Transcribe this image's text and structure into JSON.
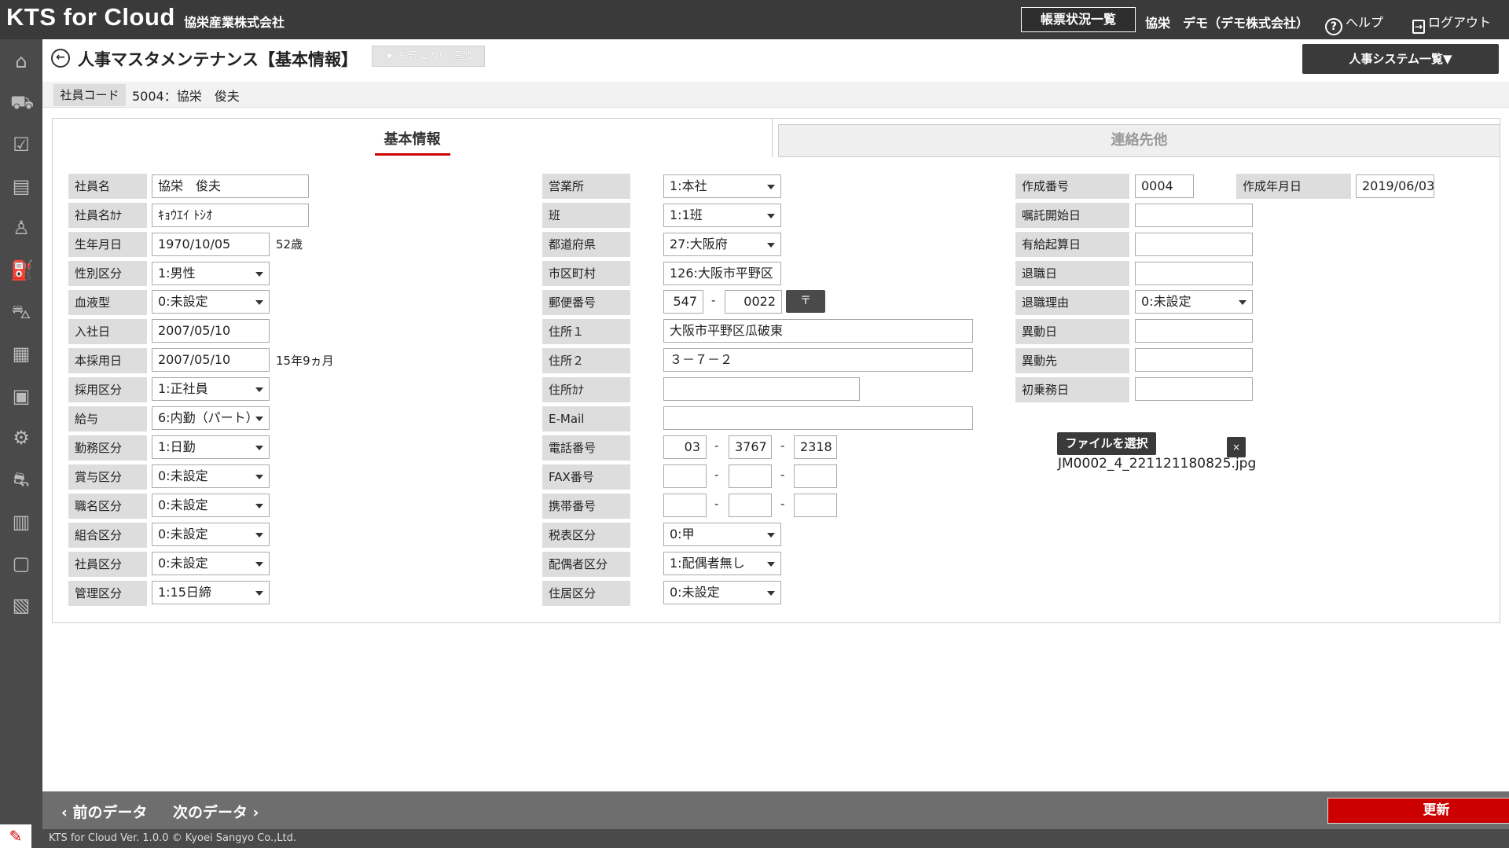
{
  "header": {
    "logo": "KTS for Cloud",
    "company": "協栄産業株式会社",
    "report_status_button": "帳票状況一覧",
    "user": "協栄　デモ（デモ株式会社）",
    "help": "ヘルプ",
    "logout": "ログアウト"
  },
  "sidebar": {
    "icons": [
      "home-icon",
      "truck-icon",
      "clipboard-icon",
      "document-icon",
      "person-icon",
      "fuel-icon",
      "vehicle-icon",
      "calendar-icon",
      "id-card-icon",
      "repair-icon",
      "cars-icon",
      "building-icon",
      "briefcase-icon",
      "report-icon"
    ]
  },
  "page": {
    "title": "人事マスタメンテナンス【基本情報】",
    "favorite_button": "★ お気に入り 追加",
    "system_button": "人事システム一覧▼",
    "employee_code_label": "社員コード",
    "employee_code_value": "5004：協栄　俊夫"
  },
  "tabs": {
    "basic": "基本情報",
    "contact": "連絡先他"
  },
  "form": {
    "col1": {
      "name_label": "社員名",
      "name_value": "協栄　俊夫",
      "kana_label": "社員名ｶﾅ",
      "kana_value": "ｷｮｳｴｲ ﾄｼｵ",
      "birth_label": "生年月日",
      "birth_value": "1970/10/05",
      "age": "52歳",
      "gender_label": "性別区分",
      "gender_value": "1:男性",
      "blood_label": "血液型",
      "blood_value": "0:未設定",
      "join_label": "入社日",
      "join_value": "2007/05/10",
      "hire_label": "本採用日",
      "hire_value": "2007/05/10",
      "tenure": "15年9ヵ月",
      "employ_label": "採用区分",
      "employ_value": "1:正社員",
      "salary_label": "給与",
      "salary_value": "6:内勤（パート）",
      "work_label": "勤務区分",
      "work_value": "1:日勤",
      "bonus_label": "賞与区分",
      "bonus_value": "0:未設定",
      "position_label": "職名区分",
      "position_value": "0:未設定",
      "union_label": "組合区分",
      "union_value": "0:未設定",
      "emp_type_label": "社員区分",
      "emp_type_value": "0:未設定",
      "manage_label": "管理区分",
      "manage_value": "1:15日締"
    },
    "col2": {
      "office_label": "営業所",
      "office_value": "1:本社",
      "group_label": "班",
      "group_value": "1:1班",
      "pref_label": "都道府県",
      "pref_value": "27:大阪府",
      "city_label": "市区町村",
      "city_value": "126:大阪市平野区",
      "zip_label": "郵便番号",
      "zip1": "547",
      "zip2": "0022",
      "zip_button": "〒",
      "addr1_label": "住所１",
      "addr1_value": "大阪市平野区瓜破東",
      "addr2_label": "住所２",
      "addr2_value": "３－７－２",
      "addr_kana_label": "住所ｶﾅ",
      "addr_kana_value": "",
      "email_label": "E-Mail",
      "email_value": "",
      "tel_label": "電話番号",
      "tel1": "03",
      "tel2": "3767",
      "tel3": "2318",
      "fax_label": "FAX番号",
      "fax1": "",
      "fax2": "",
      "fax3": "",
      "mobile_label": "携帯番号",
      "mobile1": "",
      "mobile2": "",
      "mobile3": "",
      "tax_label": "税表区分",
      "tax_value": "0:甲",
      "spouse_label": "配偶者区分",
      "spouse_value": "1:配偶者無し",
      "residence_label": "住居区分",
      "residence_value": "0:未設定",
      "dash": "-"
    },
    "col3": {
      "created_no_label": "作成番号",
      "created_no_value": "0004",
      "created_date_label": "作成年月日",
      "created_date_value": "2019/06/03",
      "contract_label": "嘱託開始日",
      "contract_value": "",
      "paid_leave_label": "有給起算日",
      "paid_leave_value": "",
      "retire_label": "退職日",
      "retire_value": "",
      "retire_reason_label": "退職理由",
      "retire_reason_value": "0:未設定",
      "transfer_date_label": "異動日",
      "transfer_date_value": "",
      "transfer_to_label": "異動先",
      "transfer_to_value": "",
      "first_ride_label": "初乗務日",
      "first_ride_value": "",
      "file_button": "ファイルを選択",
      "file_close": "×",
      "file_name": "JM0002_4_221121180825.jpg"
    }
  },
  "footer": {
    "prev": "前のデータ",
    "next": "次のデータ",
    "update": "更新",
    "copyright": "KTS for Cloud Ver. 1.0.0 © Kyoei Sangyo Co.,Ltd."
  },
  "colors": {
    "header_bg": "#3a3a3a",
    "accent_red": "#cc0000",
    "label_bg": "#dddddd"
  }
}
